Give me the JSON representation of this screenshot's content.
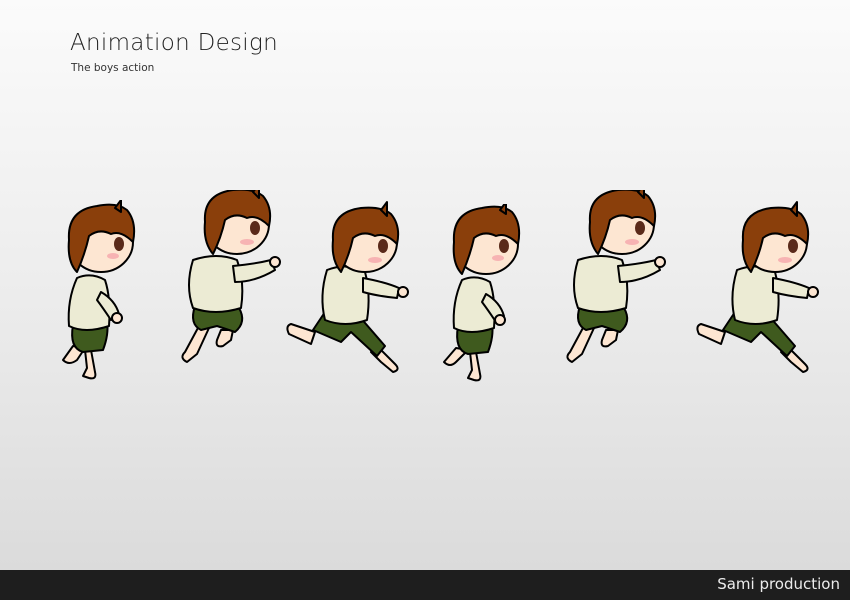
{
  "header": {
    "title": "Animation Design",
    "subtitle": "The boys action"
  },
  "sprite_sheet": {
    "frame_count": 6,
    "character": "boy-running",
    "colors": {
      "hair": "#8a3f0b",
      "skin": "#fde6d2",
      "shirt": "#ecebd4",
      "pants": "#3f5a1e",
      "outline": "#000000"
    }
  },
  "footer": {
    "credit": "Sami production"
  }
}
